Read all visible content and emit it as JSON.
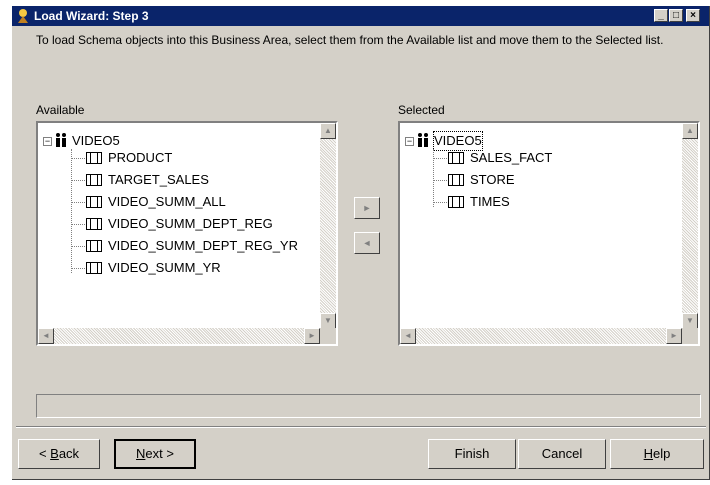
{
  "window": {
    "title": "Load Wizard: Step 3"
  },
  "instructions": "To load Schema objects into this Business Area, select them from the Available list and move them to the Selected list.",
  "available": {
    "label": "Available",
    "root": "VIDEO5",
    "items": [
      "PRODUCT",
      "TARGET_SALES",
      "VIDEO_SUMM_ALL",
      "VIDEO_SUMM_DEPT_REG",
      "VIDEO_SUMM_DEPT_REG_YR",
      "VIDEO_SUMM_YR"
    ]
  },
  "selected": {
    "label": "Selected",
    "root": "VIDEO5",
    "items": [
      "SALES_FACT",
      "STORE",
      "TIMES"
    ]
  },
  "buttons": {
    "back_pre": "< ",
    "back_key": "B",
    "back_post": "ack",
    "next_key": "N",
    "next_post": "ext >",
    "finish": "Finish",
    "cancel": "Cancel",
    "help_key": "H",
    "help_post": "elp"
  }
}
